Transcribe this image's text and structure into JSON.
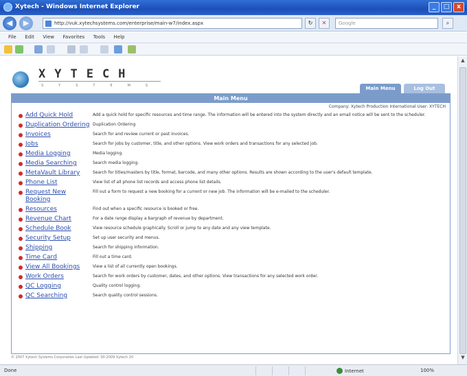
{
  "window": {
    "title": "Xytech - Windows Internet Explorer",
    "buttons": [
      "_",
      "□",
      "x"
    ]
  },
  "browser": {
    "address": "http://vuk.xytechsystems.com/enterprise/main-w7/index.aspx",
    "search_placeholder": "Google",
    "menu": [
      "File",
      "Edit",
      "View",
      "Favorites",
      "Tools",
      "Help"
    ]
  },
  "page": {
    "logo_text": "XYTECH",
    "logo_sub": "SYSTEMS",
    "tabs": [
      "Main Menu",
      "Log Out"
    ],
    "panel_title": "Main Menu",
    "company_line": "Company: Xytech Production International   User: XYTECH",
    "menu_items": [
      {
        "label": "Add Quick Hold",
        "desc": "Add a quick hold for specific resources and time range. The information will be entered into the system directly and an email notice will be sent to the scheduler."
      },
      {
        "label": "Duplication Ordering",
        "desc": "Duplication Ordering"
      },
      {
        "label": "Invoices",
        "desc": "Search for and review current or past invoices."
      },
      {
        "label": "Jobs",
        "desc": "Search for jobs by customer, title, and other options. View work orders and transactions for any selected job."
      },
      {
        "label": "Media Logging",
        "desc": "Media logging."
      },
      {
        "label": "Media Searching",
        "desc": "Search media logging."
      },
      {
        "label": "MetaVault Library",
        "desc": "Search for titles/masters by title, format, barcode, and many other options. Results are shown according to the user's default template."
      },
      {
        "label": "Phone List",
        "desc": "View list of all phone list records and access phone list details."
      },
      {
        "label": "Request New Booking",
        "desc": "Fill out a form to request a new booking for a current or new job. The information will be e-mailed to the scheduler."
      },
      {
        "label": "Resources",
        "desc": "Find out when a specific resource is booked or free."
      },
      {
        "label": "Revenue Chart",
        "desc": "For a date range display a bargraph of revenue by department."
      },
      {
        "label": "Schedule Book",
        "desc": "View resource schedule graphically. Scroll or jump to any date and any view template."
      },
      {
        "label": "Security Setup",
        "desc": "Set up user security and menus."
      },
      {
        "label": "Shipping",
        "desc": "Search for shipping information."
      },
      {
        "label": "Time Card",
        "desc": "Fill out a time card."
      },
      {
        "label": "View All Bookings",
        "desc": "View a list of all currently open bookings."
      },
      {
        "label": "Work Orders",
        "desc": "Search for work orders by customer, dates, and other options. View transactions for any selected work order."
      },
      {
        "label": "QC Logging",
        "desc": "Quality control logging."
      },
      {
        "label": "QC Searching",
        "desc": "Search quality control sessions."
      }
    ],
    "footer": "© 2007 Xytech Systems Corporation   Last Updated: 00-2009 Xytech 20"
  },
  "status": {
    "left": "Done",
    "zone": "Internet",
    "zoom": "100%"
  },
  "colors": {
    "accent": "#7b9ccb",
    "link": "#2a4fb0",
    "bullet": "#d42a2a"
  }
}
